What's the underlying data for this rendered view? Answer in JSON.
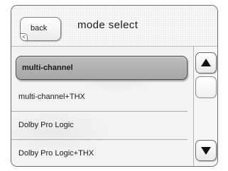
{
  "header": {
    "back_label": "back",
    "back_icon": "corner-arrow-icon",
    "title": "mode select"
  },
  "modes": [
    {
      "label": "multi-channel",
      "selected": true
    },
    {
      "label": "multi-channel+THX",
      "selected": false
    },
    {
      "label": "Dolby Pro Logic",
      "selected": false
    },
    {
      "label": "Dolby Pro Logic+THX",
      "selected": false
    }
  ],
  "scrollbar": {
    "up_icon": "triangle-up-icon",
    "down_icon": "triangle-down-icon"
  },
  "colors": {
    "selected_fill": "#b3b3b3",
    "frame": "#6d6d6d"
  }
}
